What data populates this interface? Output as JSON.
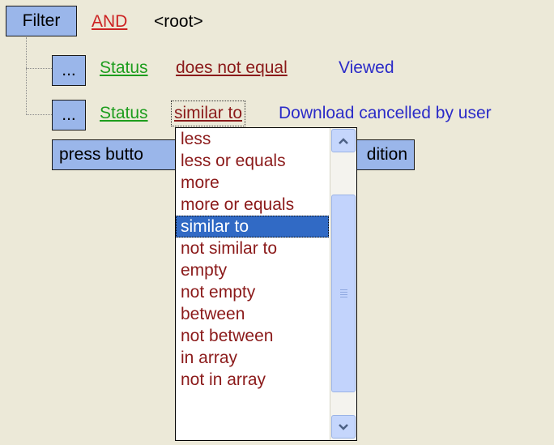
{
  "colors": {
    "background": "#ece9d8",
    "button_fill": "#9ab6ea",
    "operator_red": "#cc2222",
    "field_green": "#1d9d1d",
    "condition_darkred": "#8b1a1a",
    "value_blue": "#2b2bc8",
    "dropdown_item": "#8b1a1a",
    "selection": "#316ac5"
  },
  "filter": {
    "filter_button": "Filter",
    "group_operator": "AND",
    "root_label": "<root>"
  },
  "conditions": [
    {
      "menu_button": "...",
      "field": "Status",
      "operator": "does not equal",
      "value": "Viewed"
    },
    {
      "menu_button": "...",
      "field": "Status",
      "operator": "similar to",
      "value": "Download cancelled by user"
    }
  ],
  "add_condition_button": {
    "left_text": "press butto",
    "right_text": "dition"
  },
  "dropdown": {
    "selected": "similar to",
    "items": [
      "less",
      "less or equals",
      "more",
      "more or equals",
      "similar to",
      "not similar to",
      "empty",
      "not empty",
      "between",
      "not between",
      "in array",
      "not in array"
    ],
    "scroll_up_icon": "scroll-up-arrow",
    "scroll_down_icon": "scroll-down-arrow",
    "grip_icon": "scroll-thumb-grip"
  }
}
